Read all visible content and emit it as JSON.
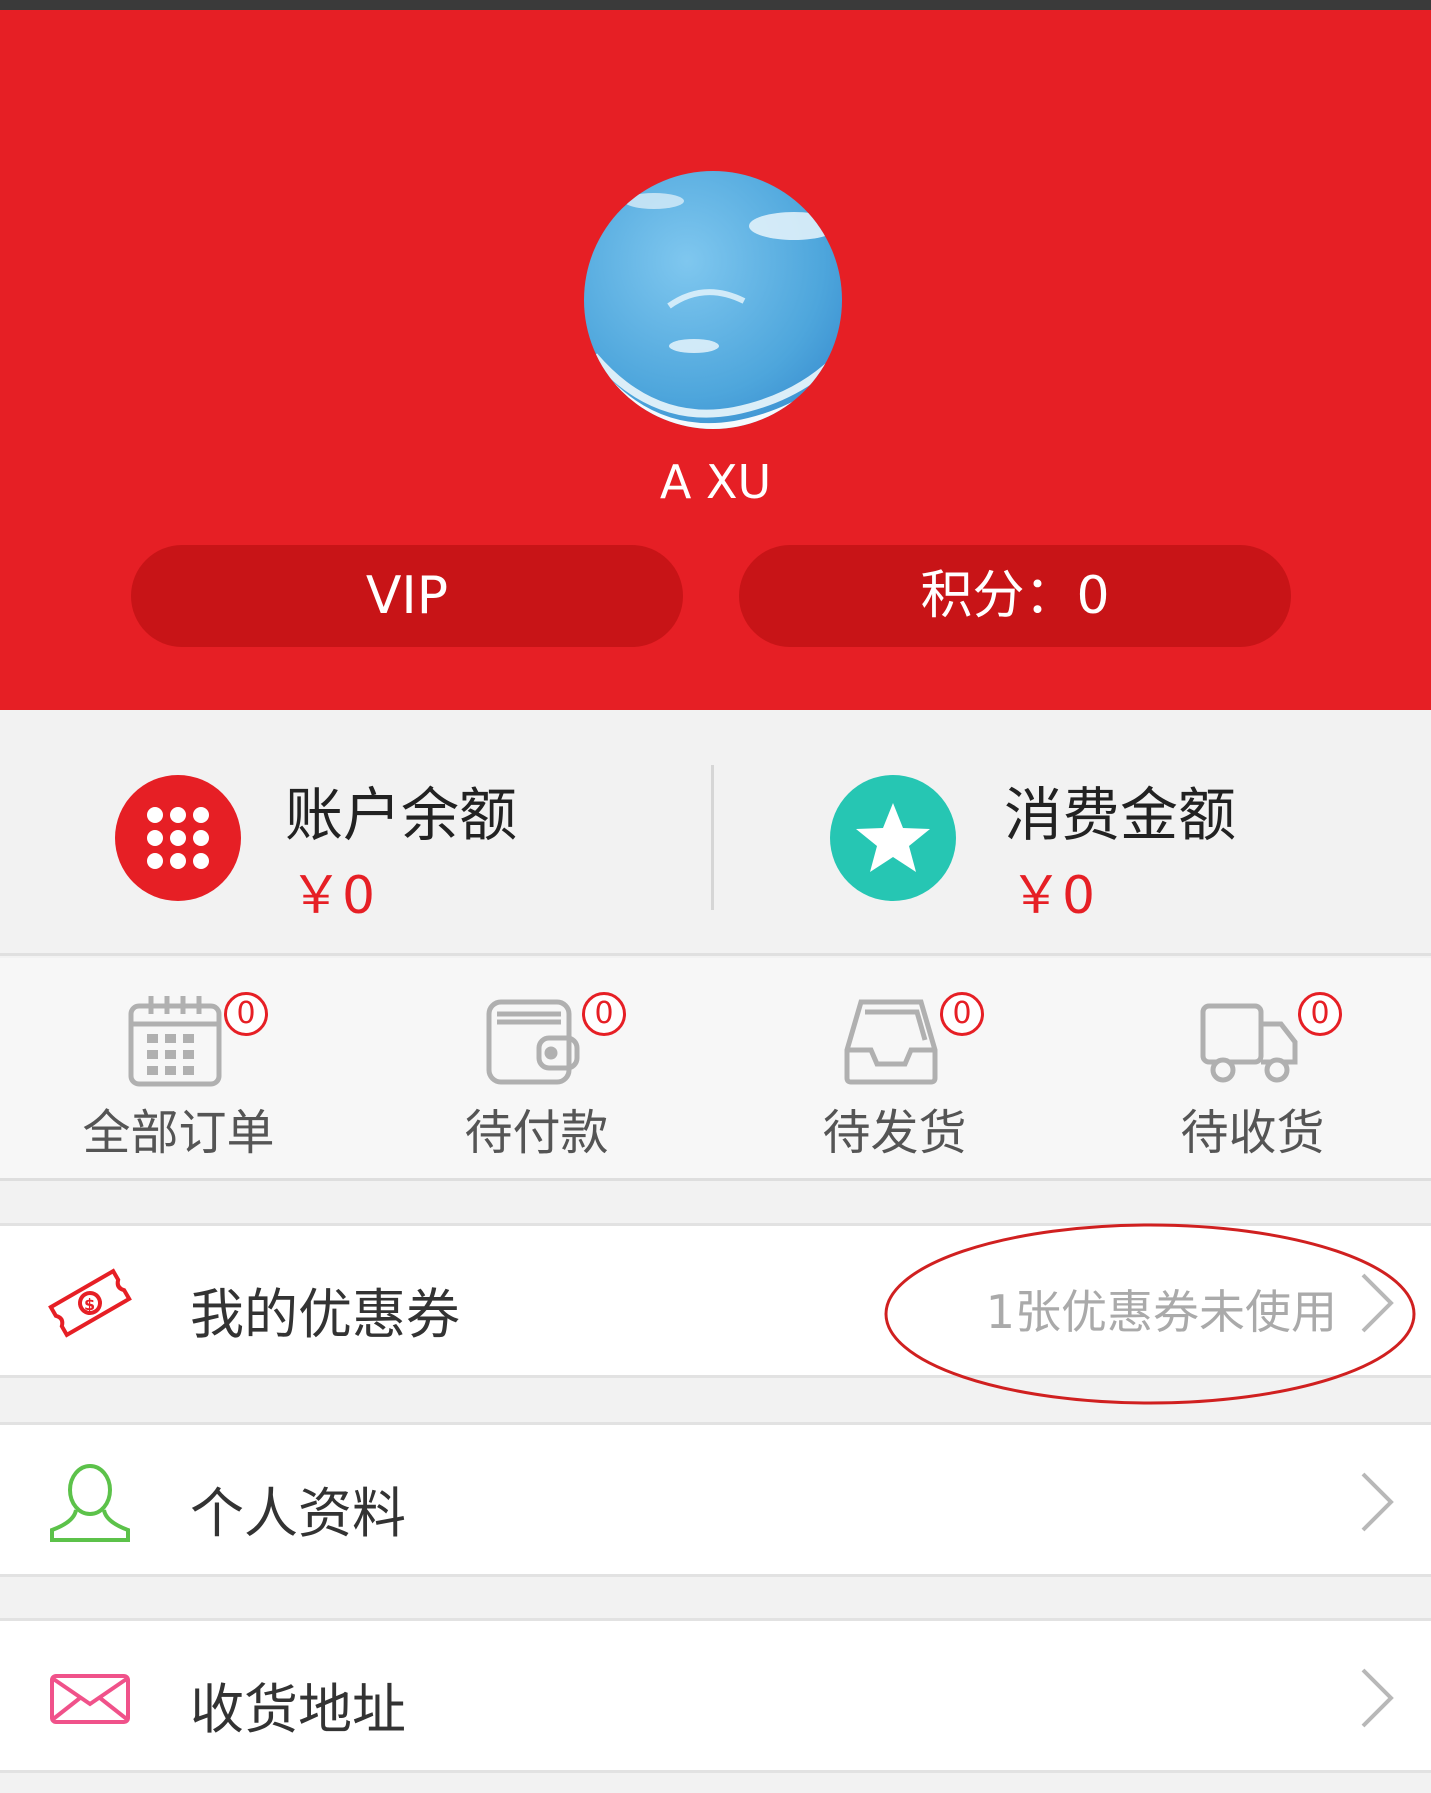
{
  "profile": {
    "username": "A XU",
    "vip_label": "VIP",
    "points_label": "积分：0"
  },
  "balance": {
    "account_label": "账户余额",
    "account_value": "￥0",
    "spend_label": "消费金额",
    "spend_value": "￥0"
  },
  "orders": [
    {
      "label": "全部订单",
      "count": "0",
      "icon": "calendar-icon"
    },
    {
      "label": "待付款",
      "count": "0",
      "icon": "wallet-icon"
    },
    {
      "label": "待发货",
      "count": "0",
      "icon": "inbox-icon"
    },
    {
      "label": "待收货",
      "count": "0",
      "icon": "truck-icon"
    }
  ],
  "menu": {
    "coupons": {
      "label": "我的优惠券",
      "extra": "1张优惠券未使用",
      "icon": "coupon-icon"
    },
    "profile": {
      "label": "个人资料",
      "icon": "person-icon"
    },
    "address": {
      "label": "收货地址",
      "icon": "envelope-icon"
    }
  },
  "colors": {
    "brand_red": "#e61f25",
    "pill_red": "#c81417",
    "teal": "#26c6b3",
    "green": "#5cc24a",
    "pink": "#f0528a",
    "annotation": "#d02020"
  }
}
